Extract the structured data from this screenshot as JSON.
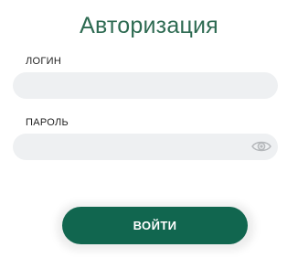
{
  "form": {
    "title": "Авторизация",
    "login_label": "ЛОГИН",
    "login_value": "",
    "password_label": "ПАРОЛЬ",
    "password_value": "",
    "submit_label": "ВОЙТИ",
    "password_toggle_icon": "eye-icon"
  },
  "colors": {
    "title": "#2e6b52",
    "button": "#11664f",
    "input_bg": "#eef0f2"
  }
}
